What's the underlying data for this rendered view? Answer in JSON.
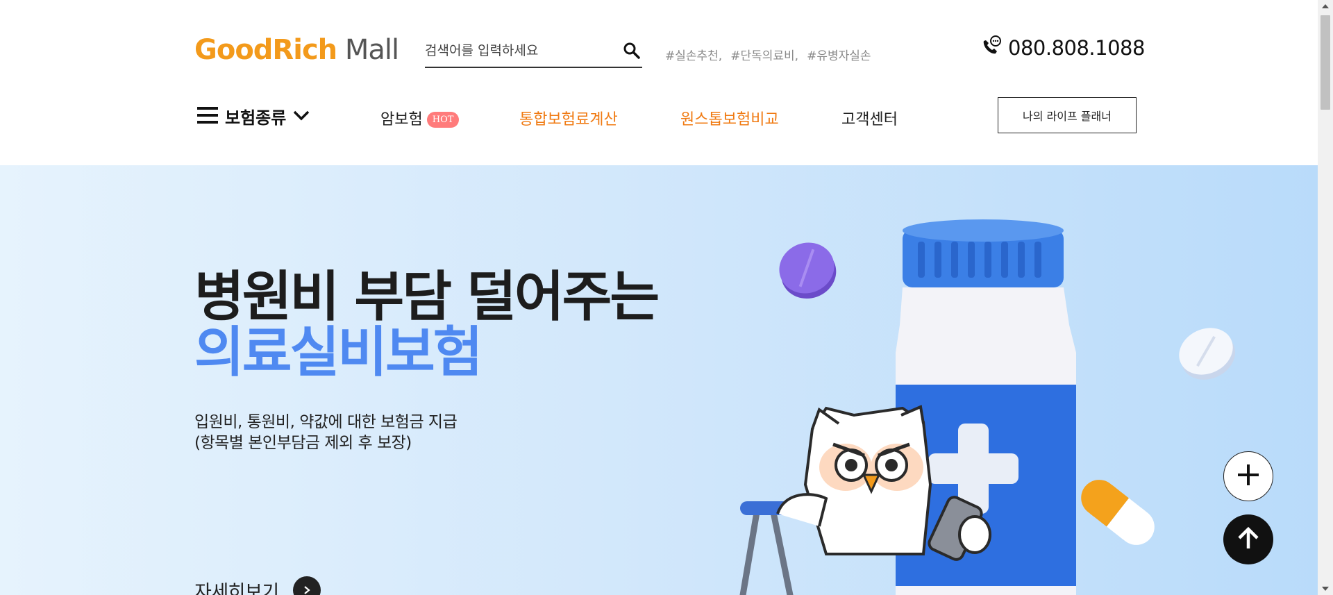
{
  "header": {
    "logo_part1": "GoodRich",
    "logo_part2": " Mall",
    "search": {
      "placeholder": "검색어를 입력하세요"
    },
    "tags": [
      "#실손추천,",
      "#단독의료비,",
      "#유병자실손"
    ],
    "phone": "080.808.1088"
  },
  "nav": {
    "menu_label": "보험종류",
    "items": [
      {
        "label": "암보험",
        "badge": "HOT"
      },
      {
        "label": "통합보험료계산"
      },
      {
        "label": "원스톱보험비교"
      },
      {
        "label": "고객센터"
      }
    ],
    "planner_button": "나의 라이프 플래너"
  },
  "hero": {
    "title_line1": "병원비 부담 덜어주는",
    "title_line2": "의료실비보험",
    "desc_line1": "입원비, 통원비, 약값에 대한 보험금 지급",
    "desc_line2": "(항목별 본인부담금 제외 후 보장)",
    "more_label": "자세히보기"
  },
  "colors": {
    "logo_orange": "#f39a1b",
    "nav_orange": "#f07a12",
    "hero_blue_text": "#4f89f1",
    "hot_badge": "#ff7b7b"
  },
  "icons": [
    "search-icon",
    "phone-chat-icon",
    "hamburger-icon",
    "chevron-down-icon",
    "arrow-right-icon",
    "plus-icon",
    "arrow-up-icon"
  ]
}
